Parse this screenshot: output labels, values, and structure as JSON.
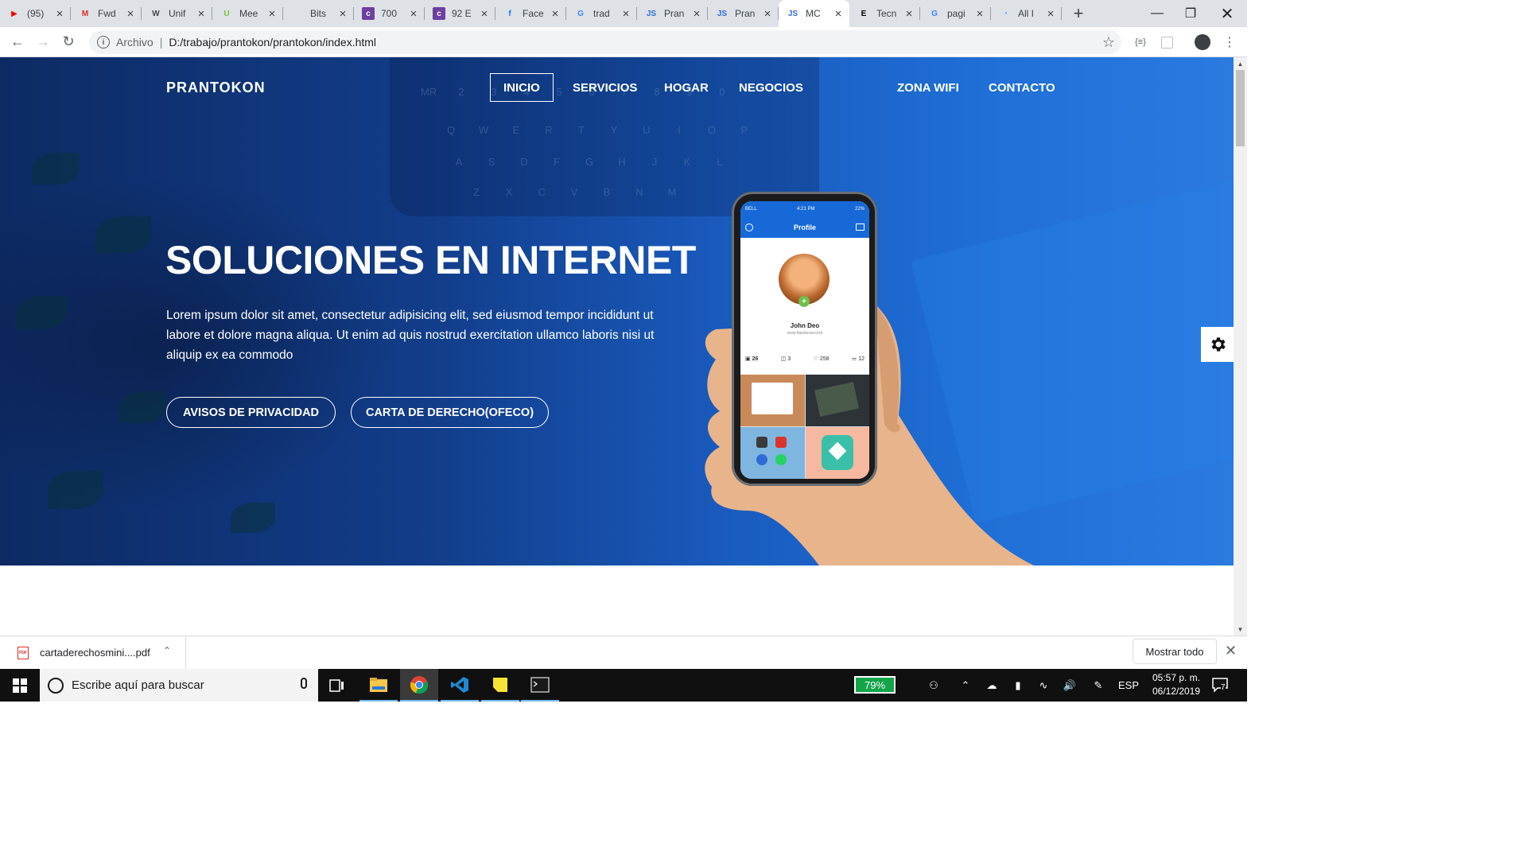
{
  "browser": {
    "tabs": [
      {
        "title": "(95)",
        "icon": "youtube-icon",
        "color": "#ff0000",
        "glyph": "▶"
      },
      {
        "title": "Fwd",
        "icon": "gmail-icon",
        "color": "#d93025",
        "glyph": "M"
      },
      {
        "title": "Unif",
        "icon": "unifi-icon",
        "color": "#444444",
        "glyph": "W"
      },
      {
        "title": "Mee",
        "icon": "udemy-icon",
        "color": "#7cc242",
        "glyph": "U"
      },
      {
        "title": "Bits",
        "icon": "blank-icon",
        "color": "#dee1e6",
        "glyph": ""
      },
      {
        "title": "700",
        "icon": "colorlib-icon",
        "color": "#6c3fa0",
        "glyph": "c"
      },
      {
        "title": "92 E",
        "icon": "colorlib-icon",
        "color": "#6c3fa0",
        "glyph": "c"
      },
      {
        "title": "Face",
        "icon": "facebook-icon",
        "color": "#1877f2",
        "glyph": "f"
      },
      {
        "title": "trad",
        "icon": "google-icon",
        "color": "#4285f4",
        "glyph": "G"
      },
      {
        "title": "Pran",
        "icon": "js-icon",
        "color": "#2d6cdf",
        "glyph": "JS"
      },
      {
        "title": "Pran",
        "icon": "js-icon",
        "color": "#2d6cdf",
        "glyph": "JS"
      },
      {
        "title": "MC",
        "icon": "js-icon",
        "color": "#2d6cdf",
        "glyph": "JS"
      },
      {
        "title": "Tecn",
        "icon": "e-icon",
        "color": "#000000",
        "glyph": "E"
      },
      {
        "title": "pagi",
        "icon": "google-icon",
        "color": "#4285f4",
        "glyph": "G"
      },
      {
        "title": "All I",
        "icon": "ionic-icon",
        "color": "#3ab0e0",
        "glyph": "◔"
      }
    ],
    "active_tab_index": 11,
    "address": {
      "scheme": "Archivo",
      "url": "D:/trabajo/prantokon/prantokon/index.html"
    }
  },
  "page": {
    "brand": "PRANTOKON",
    "nav": [
      "INICIO",
      "SERVICIOS",
      "HOGAR",
      "NEGOCIOS",
      "ZONA WIFI",
      "CONTACTO"
    ],
    "hero": {
      "title": "SOLUCIONES EN INTERNET",
      "text": "Lorem ipsum dolor sit amet, consectetur adipisicing elit, sed eiusmod tempor incididunt ut labore et dolore magna aliqua. Ut enim ad quis nostrud exercitation ullamco laboris nisi ut aliquip ex ea commodo",
      "button_primary": "AVISOS DE PRIVACIDAD",
      "button_secondary": "CARTA DE DERECHO(OFECO)"
    },
    "phone": {
      "carrier": "BELL",
      "time": "4:21 PM",
      "battery": "22%",
      "header": "Profile",
      "name": "John Deo",
      "site": "www.hipstacow.com",
      "stats": [
        "26",
        "3",
        "258",
        "12"
      ]
    },
    "keyboard_rows": [
      [
        "MR",
        "2",
        "3",
        "4",
        "5",
        "6",
        "7",
        "8",
        "9",
        "0"
      ],
      [
        "Q",
        "W",
        "E",
        "R",
        "T",
        "Y",
        "U",
        "I",
        "O",
        "P"
      ],
      [
        "A",
        "S",
        "D",
        "F",
        "G",
        "H",
        "J",
        "K",
        "L"
      ],
      [
        "Z",
        "X",
        "C",
        "V",
        "B",
        "N",
        "M"
      ]
    ]
  },
  "downloads": {
    "file": "cartaderechosmini....pdf",
    "pdf_label": "PDF",
    "show_all": "Mostrar todo"
  },
  "taskbar": {
    "search_placeholder": "Escribe aquí para buscar",
    "battery": "79%",
    "language": "ESP",
    "time": "05:57 p. m.",
    "date": "06/12/2019",
    "notifications": "7"
  },
  "colors": {
    "hero_dark": "#0d2a63",
    "hero_light": "#2a7ae0",
    "phone_blue": "#1769d8"
  }
}
